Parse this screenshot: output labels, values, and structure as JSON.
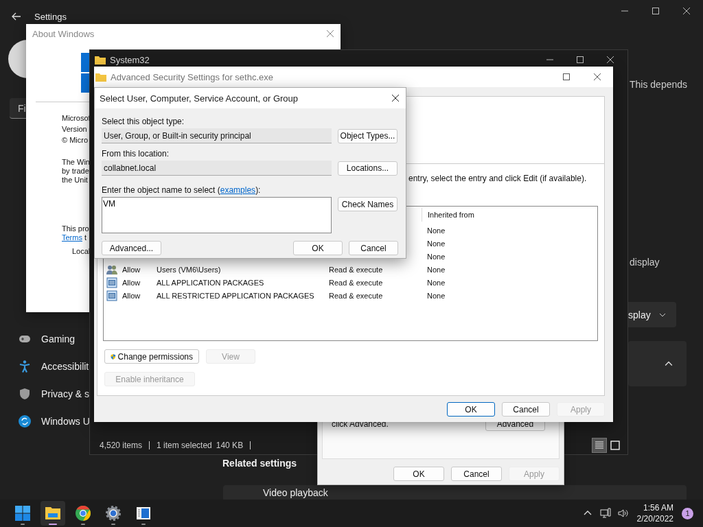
{
  "settings": {
    "title": "Settings",
    "search": {
      "value": "Fi"
    },
    "sidebar": {
      "items": [
        {
          "label": "Gaming"
        },
        {
          "label": "Accessibilit"
        },
        {
          "label": "Privacy & s"
        },
        {
          "label": "Windows U"
        }
      ]
    },
    "content": {
      "description_fragment": "This depends",
      "option_fragment": "display",
      "dropdown": {
        "value": "splay"
      },
      "related_heading": "Related settings",
      "related_item": "Video playback"
    }
  },
  "about_window": {
    "title": "About Windows",
    "info_lines": [
      "Microsof",
      "Version",
      "© Micro"
    ],
    "paragraph_lines": [
      "The Win",
      "by trade",
      "the Unit"
    ],
    "license_line": "This pro",
    "terms_link": "Terms",
    "terms_rest": "t",
    "user_line": "Local"
  },
  "explorer_window": {
    "title": "System32",
    "status": {
      "item_count": "4,520 items",
      "selection": "1 item selected",
      "size": "140 KB"
    },
    "view_buttons": [
      {
        "selected": true
      },
      {
        "selected": false
      }
    ]
  },
  "properties_window": {
    "text": "click Advanced.",
    "advanced_button": "Advanced",
    "footer_buttons": [
      {
        "label": "OK",
        "disabled": false
      },
      {
        "label": "Cancel",
        "disabled": false
      },
      {
        "label": "Apply",
        "disabled": true
      }
    ]
  },
  "security_window": {
    "title": "Advanced Security Settings for sethc.exe",
    "instruction": "entry, select the entry and click Edit (if available).",
    "table": {
      "columns": [
        "Inherited from"
      ],
      "rows": [
        {
          "inherited": "None"
        },
        {
          "inherited": "None"
        },
        {
          "inherited": "None"
        },
        {
          "kind": "group",
          "type": "Allow",
          "principal": "Users (VM6\\Users)",
          "access": "Read & execute",
          "inherited": "None"
        },
        {
          "kind": "package",
          "type": "Allow",
          "principal": "ALL APPLICATION PACKAGES",
          "access": "Read & execute",
          "inherited": "None"
        },
        {
          "kind": "package",
          "type": "Allow",
          "principal": "ALL RESTRICTED APPLICATION PACKAGES",
          "access": "Read & execute",
          "inherited": "None"
        }
      ]
    },
    "buttons": [
      {
        "label": "Change permissions",
        "kind": "shield",
        "disabled": false
      },
      {
        "label": "View",
        "kind": "plain",
        "disabled": true
      },
      {
        "label": "Enable inheritance",
        "kind": "plain",
        "disabled": true
      }
    ],
    "footer_buttons": [
      {
        "label": "OK",
        "default": true,
        "disabled": false
      },
      {
        "label": "Cancel",
        "default": false,
        "disabled": false
      },
      {
        "label": "Apply",
        "default": false,
        "disabled": true
      }
    ]
  },
  "select_dialog": {
    "title": "Select User, Computer, Service Account, or Group",
    "object_type": {
      "label": "Select this object type:",
      "value": "User, Group, or Built-in security principal",
      "button": "Object Types..."
    },
    "location": {
      "label": "From this location:",
      "value": "collabnet.local",
      "button": "Locations..."
    },
    "name_entry": {
      "label_start": "Enter the object name to select (",
      "link": "examples",
      "label_end": "):",
      "value": "VM",
      "button": "Check Names"
    },
    "buttons": [
      "Advanced...",
      "OK",
      "Cancel"
    ]
  },
  "taskbar": {
    "apps": [
      {
        "kind": "start",
        "selected": false
      },
      {
        "kind": "explorer",
        "selected": true
      },
      {
        "kind": "chrome",
        "selected": false
      },
      {
        "kind": "settings",
        "selected": false
      },
      {
        "kind": "viewer",
        "selected": false
      }
    ],
    "time": "1:56 AM",
    "date": "2/20/2022",
    "notification_count": "1"
  }
}
